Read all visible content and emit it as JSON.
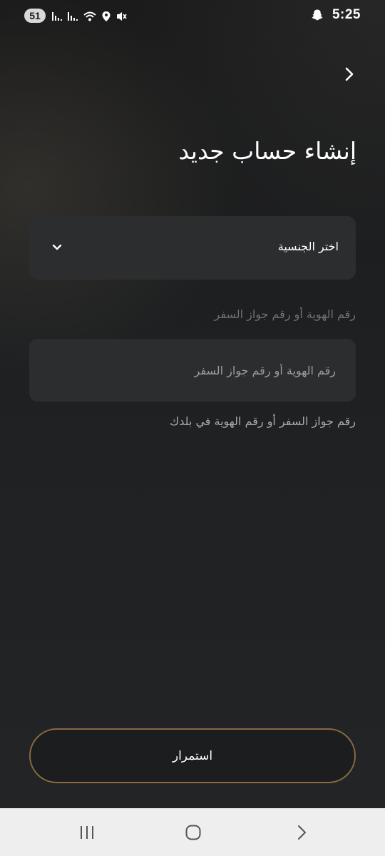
{
  "status_bar": {
    "badge": "51",
    "time": "5:25",
    "icons": [
      "signal-1-icon",
      "signal-2-icon",
      "wifi-icon",
      "location-icon",
      "mute-icon",
      "snapchat-icon"
    ]
  },
  "header": {
    "back_icon": "chevron-right-icon",
    "title": "إنشاء حساب جديد"
  },
  "form": {
    "nationality_select": {
      "label": "اختر الجنسية",
      "icon": "chevron-down-icon"
    },
    "id_field": {
      "label": "رقم الهوية أو رقم جواز السفر",
      "placeholder": "رقم الهوية أو رقم جواز السفر",
      "value": "",
      "helper": "رقم جواز السفر أو رقم الهوية في بلدك"
    },
    "continue_label": "استمرار"
  },
  "colors": {
    "accent_border": "#8a6a42",
    "field_bg": "#2c2d2f"
  },
  "nav_bar": {
    "icons": [
      "recent-apps-icon",
      "home-icon",
      "back-icon"
    ]
  }
}
